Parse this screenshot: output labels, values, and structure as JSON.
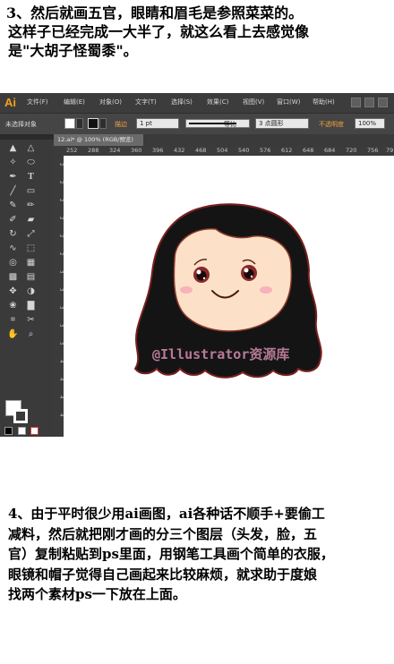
{
  "top_text": {
    "line1": "3、然后就画五官，眼睛和眉毛是参照菜菜的。",
    "line2": "这样子已经完成一大半了，就这么看上去感觉像",
    "line3": "是\"大胡子怪蜀黍\"。"
  },
  "app": {
    "logo": "Ai",
    "menus": [
      "文件(F)",
      "编辑(E)",
      "对象(O)",
      "文字(T)",
      "选择(S)",
      "效果(C)",
      "视图(V)",
      "窗口(W)",
      "帮助(H)"
    ],
    "control_bar": {
      "selection_label": "未选择对象",
      "stroke_label": "描边",
      "stroke_weight": "1 pt",
      "profile_label": "等比",
      "brush_label": "3 点圆形",
      "opacity_label": "不透明度",
      "opacity_value": "100%"
    },
    "document_tab": "12.ai* @ 100% (RGB/预览)",
    "ruler_h": [
      "252",
      "288",
      "324",
      "360",
      "396",
      "432",
      "468",
      "504",
      "540",
      "576",
      "612",
      "648",
      "684",
      "720",
      "756",
      "79"
    ],
    "ruler_v": [
      "2",
      "2",
      "2",
      "2",
      "2",
      "2",
      "3",
      "3",
      "3",
      "3",
      "3",
      "4",
      "4",
      "4",
      "4"
    ],
    "icons": {
      "tools": [
        "selection-icon",
        "direct-selection-icon",
        "magic-wand-icon",
        "lasso-icon",
        "pen-icon",
        "type-icon",
        "line-icon",
        "rectangle-icon",
        "paintbrush-icon",
        "pencil-icon",
        "blob-brush-icon",
        "eraser-icon",
        "rotate-icon",
        "scale-icon",
        "warp-icon",
        "free-transform-icon",
        "shape-builder-icon",
        "perspective-grid-icon",
        "mesh-icon",
        "gradient-icon",
        "eyedropper-icon",
        "blend-icon",
        "symbol-sprayer-icon",
        "column-graph-icon",
        "artboard-icon",
        "slice-icon",
        "hand-icon",
        "zoom-icon"
      ]
    }
  },
  "watermark": "@Illustrator资源库",
  "bottom_text": {
    "line1": "4、由于平时很少用ai画图，ai各种话不顺手+要偷工",
    "line2": "减料，然后就把刚才画的分三个图层（头发，脸，五",
    "line3": "官）复制粘贴到ps里面，用钢笔工具画个简单的衣服，",
    "line4": "眼镜和帽子觉得自己画起来比较麻烦，就求助于度娘",
    "line5": "找两个素材ps一下放在上面。"
  },
  "colors": {
    "hair": "#141414",
    "hair_outline": "#7a1f1f",
    "skin": "#fde0c8",
    "cheek": "#f5a6b6",
    "eye_iris": "#8a2a2a",
    "ai_orange": "#f7a11b"
  }
}
